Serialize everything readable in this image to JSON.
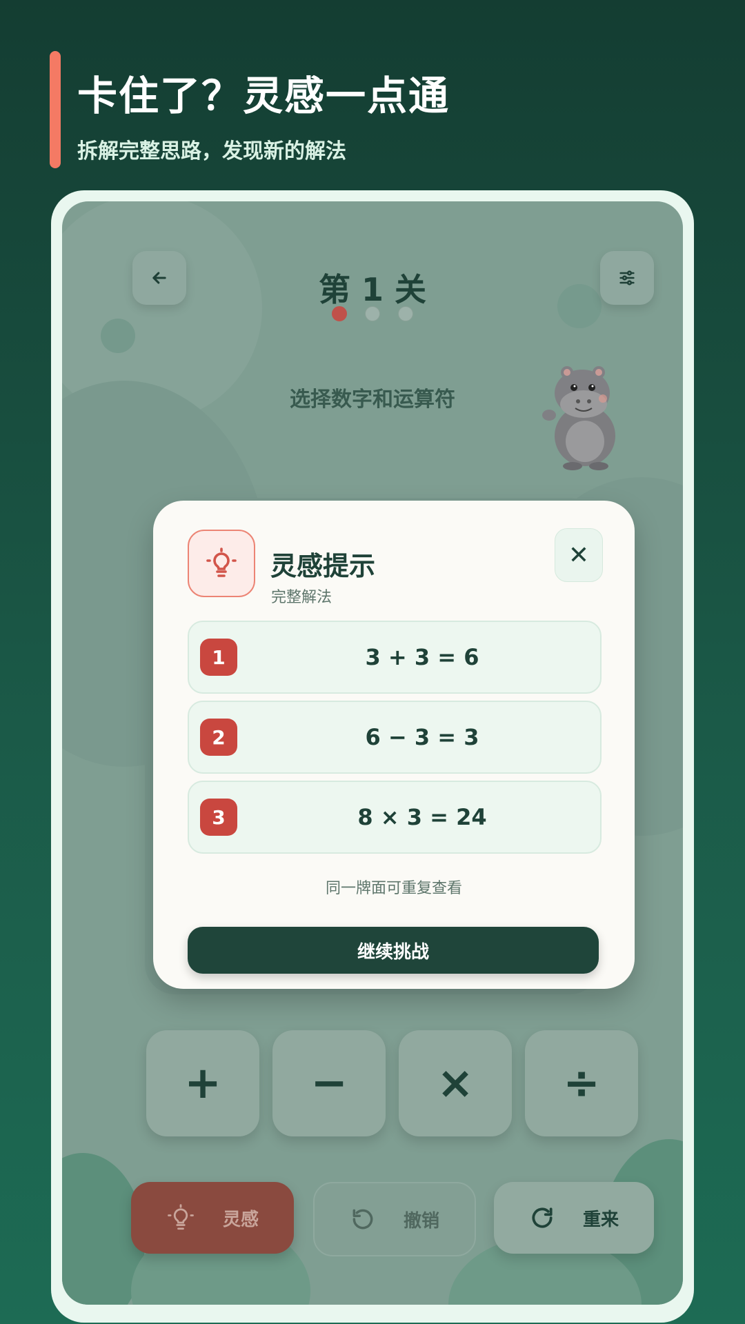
{
  "hero": {
    "title": "卡住了？灵感一点通",
    "subtitle": "拆解完整思路，发现新的解法"
  },
  "game": {
    "level_title": "第 1 关",
    "progress": {
      "total": 3,
      "current": 1
    },
    "instruction": "选择数字和运算符"
  },
  "icons": {
    "back": "arrow-left-icon",
    "settings": "sliders-icon",
    "hint": "lightbulb-icon",
    "undo": "undo-icon",
    "restart": "restart-icon",
    "close": "close-icon"
  },
  "operators": [
    "+",
    "−",
    "×",
    "÷"
  ],
  "bottom_bar": {
    "hint_label": "灵感",
    "undo_label": "撤销",
    "restart_label": "重来"
  },
  "modal": {
    "title": "灵感提示",
    "subtitle": "完整解法",
    "close_glyph": "✕",
    "steps": [
      {
        "num": "1",
        "equation": "3 + 3 = 6"
      },
      {
        "num": "2",
        "equation": "6 − 3 = 3"
      },
      {
        "num": "3",
        "equation": "8 × 3 = 24"
      }
    ],
    "note": "同一牌面可重复查看",
    "continue_label": "继续挑战"
  },
  "colors": {
    "accent": "#f47a64",
    "step_badge": "#c9473f",
    "dark_green": "#1f453a",
    "hint_button": "#8a4a3f"
  }
}
